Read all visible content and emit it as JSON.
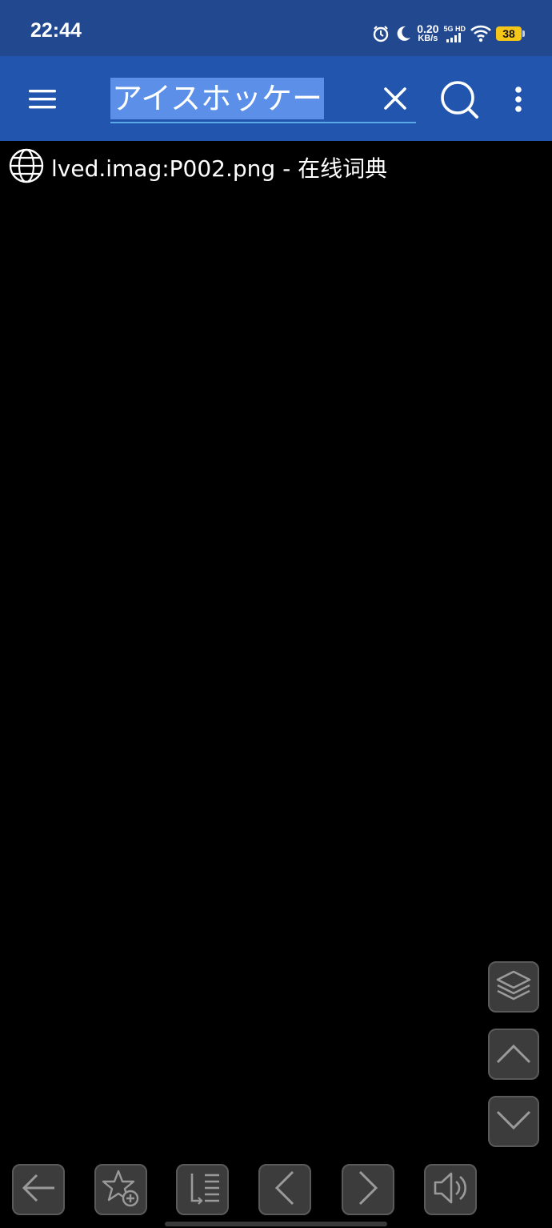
{
  "status_bar": {
    "time": "22:44",
    "net_speed_value": "0.20",
    "net_speed_unit": "KB/s",
    "signal_label": "5G HD",
    "battery_level": "38",
    "icons": [
      "alarm-icon",
      "moon-icon",
      "signal-icon",
      "wifi-icon",
      "battery-icon"
    ]
  },
  "toolbar": {
    "menu_icon": "hamburger-menu-icon",
    "search_query": "アイスホッケー",
    "clear_icon": "close-icon",
    "search_icon": "search-icon",
    "more_icon": "more-vert-icon"
  },
  "result": {
    "icon": "globe-icon",
    "title": "lved.imag:P002.png - 在线词典"
  },
  "side_buttons": [
    "layers-icon",
    "chevron-up-icon",
    "chevron-down-icon"
  ],
  "bottom_buttons": [
    "back-arrow-icon",
    "star-add-icon",
    "list-icon",
    "chevron-left-icon",
    "chevron-right-icon",
    "speaker-icon"
  ],
  "colors": {
    "status_bar_bg": "#22488f",
    "toolbar_bg": "#2255ad",
    "selection": "#5b8fe8",
    "page_bg": "#000000",
    "button_bg": "#3c3c3c",
    "battery": "#f5c518"
  }
}
